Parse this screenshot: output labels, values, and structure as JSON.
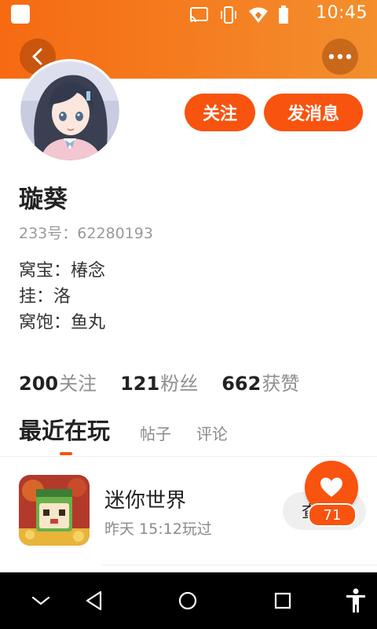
{
  "status_bar": {
    "time": "10:45",
    "icons": [
      "app-notification-icon",
      "cast-icon",
      "vibrate-icon",
      "wifi-icon",
      "battery-icon"
    ]
  },
  "header": {
    "back_icon": "back-arrow-icon",
    "more_icon": "more-dots-icon",
    "accent_color": "#f8530f"
  },
  "actions": {
    "follow_label": "关注",
    "message_label": "发消息"
  },
  "profile": {
    "username": "璇葵",
    "user_id": "233号：62280193",
    "bio_lines": [
      "窝宝：椿念",
      "挂：洛",
      "窝饱：鱼丸"
    ]
  },
  "stats": [
    {
      "value": "200",
      "label": "关注"
    },
    {
      "value": "121",
      "label": "粉丝"
    },
    {
      "value": "662",
      "label": "获赞"
    }
  ],
  "tabs": [
    {
      "label": "最近在玩",
      "active": true
    },
    {
      "label": "帖子",
      "active": false
    },
    {
      "label": "评论",
      "active": false
    }
  ],
  "games": [
    {
      "title": "迷你世界",
      "played": "昨天 15:12玩过",
      "button": "查"
    }
  ],
  "like": {
    "count": "71",
    "icon": "heart-icon"
  },
  "nav_bar": [
    "collapse-icon",
    "back-triangle-icon",
    "home-circle-icon",
    "recents-square-icon",
    "accessibility-icon"
  ]
}
